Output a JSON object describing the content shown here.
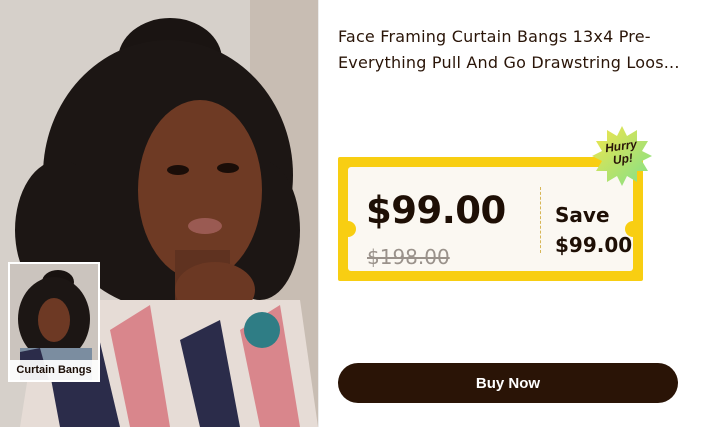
{
  "product": {
    "title_line1": "Face Framing Curtain Bangs 13x4 Pre-",
    "title_line2": "Everything Pull And Go Drawstring Loos..."
  },
  "thumbnail": {
    "label": "Curtain Bangs"
  },
  "pricing": {
    "current_price": "$99.00",
    "original_price": "$198.00",
    "save_label": "Save",
    "save_amount": "$99.00"
  },
  "badge": {
    "line1": "Hurry",
    "line2": "Up!"
  },
  "cta": {
    "buy_label": "Buy Now"
  },
  "colors": {
    "accent_yellow": "#f8ce12",
    "button_dark": "#2a1406",
    "badge_green": "#7fe08a"
  }
}
